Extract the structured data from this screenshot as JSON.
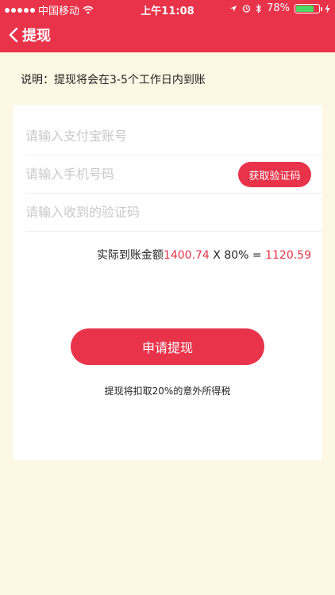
{
  "status_bar": {
    "carrier": "中国移动",
    "time": "上午11:08",
    "battery": "78%",
    "battery_level": 0.78,
    "icons": [
      "signal-dots-icon",
      "wifi-icon",
      "location-icon",
      "alarm-icon",
      "bluetooth-icon",
      "battery-icon",
      "charging-icon"
    ]
  },
  "nav": {
    "title": "提现"
  },
  "notice": "说明：提现将会在3-5个工作日内到账",
  "form": {
    "alipay_placeholder": "请输入支付宝账号",
    "phone_placeholder": "请输入手机号码",
    "code_placeholder": "请输入收到的验证码",
    "get_code_label": "获取验证码"
  },
  "amount": {
    "label": "实际到账金额",
    "base": "1400.74",
    "multiplier": " X 80% = ",
    "result": "1120.59"
  },
  "submit_label": "申请提现",
  "tax_note": "提现将扣取20%的意外所得税",
  "colors": {
    "accent": "#e8334a",
    "background": "#fdf8e4",
    "card": "#ffffff"
  }
}
